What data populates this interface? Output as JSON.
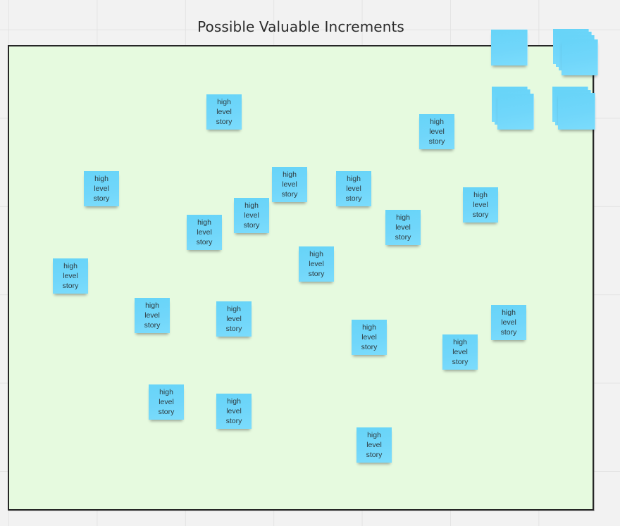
{
  "canvas": {
    "background_color": "#f2f2f2",
    "grid_color": "#e3e3e3"
  },
  "frame": {
    "title": "Possible Valuable Increments",
    "fill_color": "#e6fadf",
    "border_color": "#262626"
  },
  "sticky_color": "#6fd5f9",
  "sticky_notes": [
    {
      "text": "high\nlevel\nstory"
    },
    {
      "text": "high\nlevel\nstory"
    },
    {
      "text": "high\nlevel\nstory"
    },
    {
      "text": "high\nlevel\nstory"
    },
    {
      "text": "high\nlevel\nstory"
    },
    {
      "text": "high\nlevel\nstory"
    },
    {
      "text": "high\nlevel\nstory"
    },
    {
      "text": "high\nlevel\nstory"
    },
    {
      "text": "high\nlevel\nstory"
    },
    {
      "text": "high\nlevel\nstory"
    },
    {
      "text": "high\nlevel\nstory"
    },
    {
      "text": "high\nlevel\nstory"
    },
    {
      "text": "high\nlevel\nstory"
    },
    {
      "text": "high\nlevel\nstory"
    },
    {
      "text": "high\nlevel\nstory"
    },
    {
      "text": "high\nlevel\nstory"
    },
    {
      "text": "high\nlevel\nstory"
    },
    {
      "text": "high\nlevel\nstory"
    },
    {
      "text": "high\nlevel\nstory"
    }
  ],
  "blank_sticky_stacks": [
    {
      "name": "single",
      "count": 1
    },
    {
      "name": "stack-of-four",
      "count": 4
    },
    {
      "name": "stack-of-three-left",
      "count": 3
    },
    {
      "name": "stack-of-three-right",
      "count": 3
    }
  ]
}
